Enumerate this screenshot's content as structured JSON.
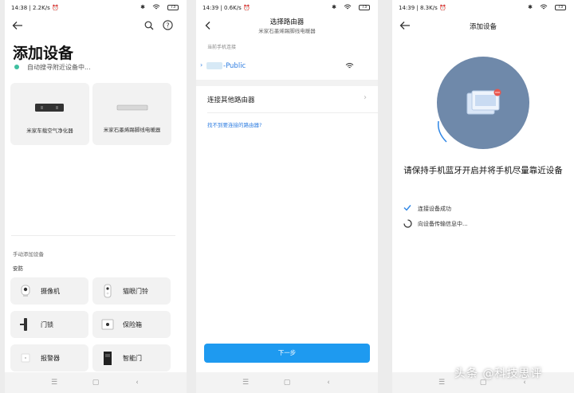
{
  "screen1": {
    "status": {
      "time": "14:38",
      "speed": "2.2K/s",
      "battery": "73"
    },
    "title": "添加设备",
    "scan_status": "自动搜寻附近设备中...",
    "found_devices": [
      {
        "name": "米家车载空气净化器"
      },
      {
        "name": "米家石墨烯踢脚线电暖器"
      }
    ],
    "manual_section": "手动添加设备",
    "category": "安防",
    "devices": [
      "摄像机",
      "猫眼门铃",
      "门锁",
      "保险箱",
      "报警器",
      "智能门"
    ]
  },
  "screen2": {
    "status": {
      "time": "14:39",
      "speed": "0.6K/s",
      "battery": "73"
    },
    "title": "选择路由器",
    "subtitle": "米家石墨烯踢脚线电暖器",
    "current_label": "当前手机连接",
    "current_network": "-Public",
    "other_router": "连接其他路由器",
    "help_link": "找不到要连接的路由器?",
    "next_button": "下一步"
  },
  "screen3": {
    "status": {
      "time": "14:39",
      "speed": "8.3K/s",
      "battery": "73"
    },
    "title": "添加设备",
    "message": "请保持手机蓝牙开启并将手机尽量靠近设备",
    "steps": [
      {
        "text": "连接设备成功",
        "state": "done"
      },
      {
        "text": "向设备传输信息中...",
        "state": "loading"
      }
    ]
  },
  "watermark": "头条 @科技思评",
  "colors": {
    "accent": "#1e9af0",
    "scan_dot": "#3fbfa0",
    "circle": "#6f89aa"
  }
}
